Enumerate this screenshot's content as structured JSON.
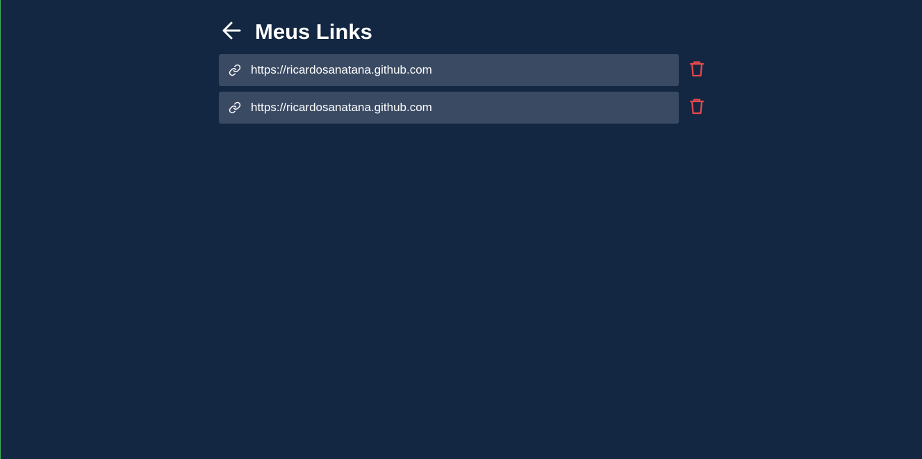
{
  "header": {
    "title": "Meus Links",
    "back_icon": "arrow-left-icon"
  },
  "links": [
    {
      "url": "https://ricardosanatana.github.com",
      "icon": "link-icon",
      "delete_icon": "trash-icon"
    },
    {
      "url": "https://ricardosanatana.github.com",
      "icon": "link-icon",
      "delete_icon": "trash-icon"
    }
  ],
  "colors": {
    "background": "#132742",
    "card": "#3a4a63",
    "text": "#ffffff",
    "delete": "#e5484d"
  }
}
